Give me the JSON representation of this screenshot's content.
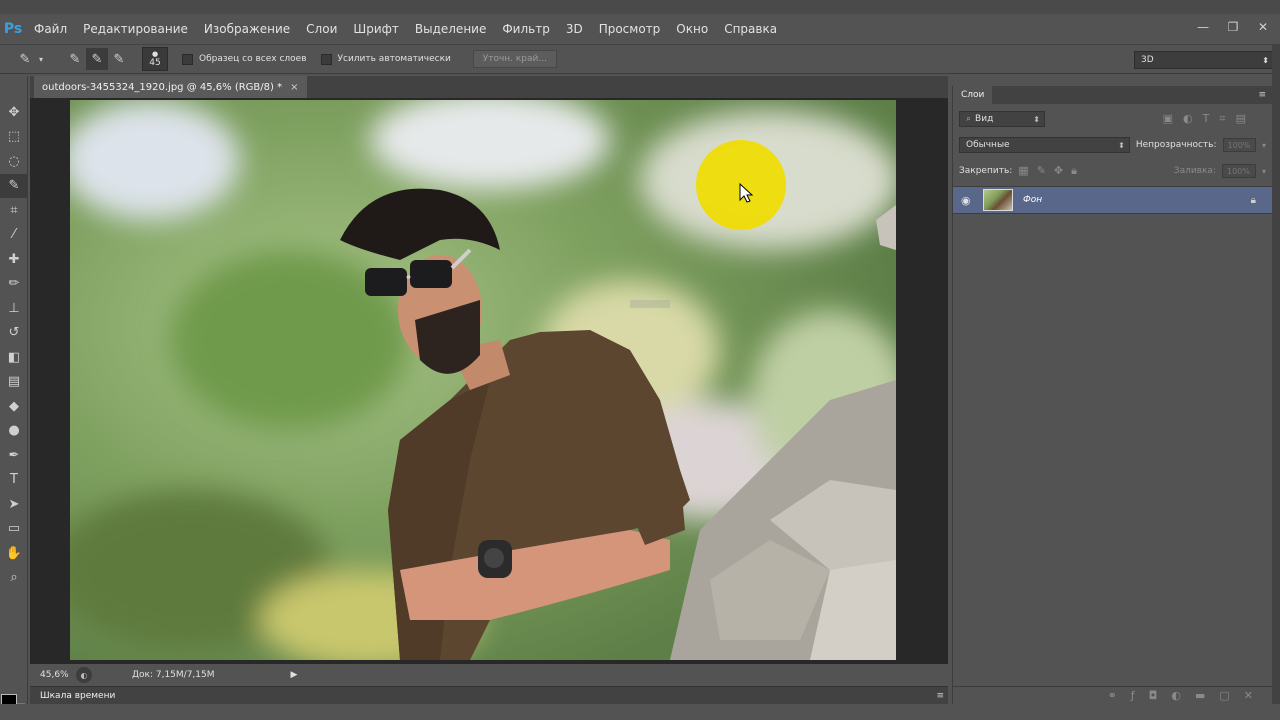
{
  "app": {
    "logo": "Ps"
  },
  "menu": [
    "Файл",
    "Редактирование",
    "Изображение",
    "Слои",
    "Шрифт",
    "Выделение",
    "Фильтр",
    "3D",
    "Просмотр",
    "Окно",
    "Справка"
  ],
  "window_controls": {
    "minimize": "—",
    "restore": "❐",
    "close": "✕"
  },
  "options": {
    "brush_size": "45",
    "sample_all_layers": "Образец со всех слоев",
    "auto_enhance": "Усилить автоматически",
    "refine_edge": "Уточн. край...",
    "workspace": "3D"
  },
  "document": {
    "tab_title": "outdoors-3455324_1920.jpg @ 45,6% (RGB/8) *",
    "close": "×"
  },
  "status": {
    "zoom": "45,6%",
    "doc": "Док: 7,15M/7,15M",
    "arrow": "▶"
  },
  "timeline": {
    "label": "Шкала времени"
  },
  "layers": {
    "tab": "Слои",
    "filter_kind": "Вид",
    "blend_mode": "Обычные",
    "opacity_label": "Непрозрачность:",
    "opacity_value": "100%",
    "lock_label": "Закрепить:",
    "fill_label": "Заливка:",
    "fill_value": "100%",
    "items": [
      {
        "name": "Фон",
        "visible": true,
        "locked": true
      }
    ]
  },
  "colors": {
    "background": "#535353",
    "selected_layer": "#59688a",
    "brush_cursor": "#f0dc00",
    "logo": "#3aa0e0"
  }
}
